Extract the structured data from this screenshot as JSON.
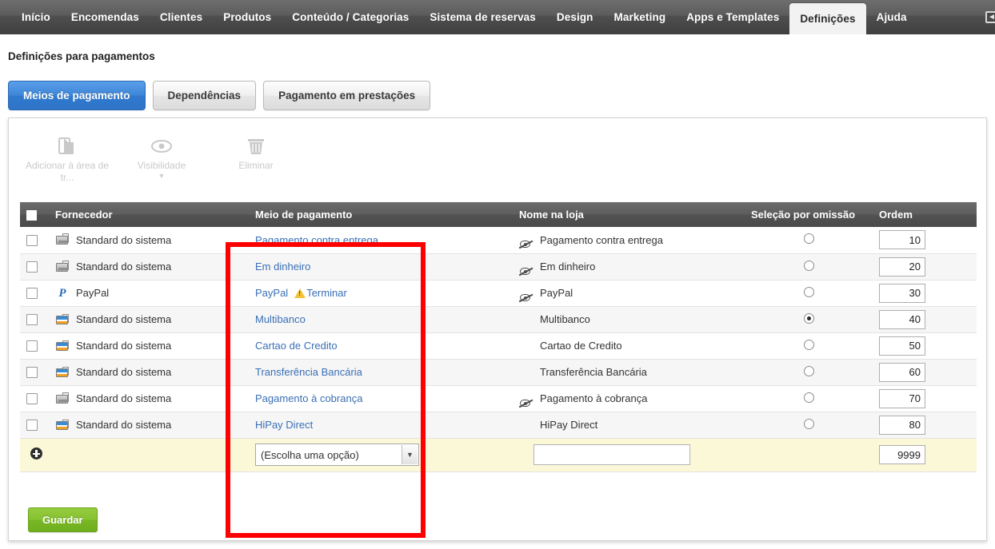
{
  "topnav": {
    "items": [
      {
        "label": "Início",
        "active": false
      },
      {
        "label": "Encomendas",
        "active": false
      },
      {
        "label": "Clientes",
        "active": false
      },
      {
        "label": "Produtos",
        "active": false
      },
      {
        "label": "Conteúdo / Categorias",
        "active": false
      },
      {
        "label": "Sistema de reservas",
        "active": false
      },
      {
        "label": "Design",
        "active": false
      },
      {
        "label": "Marketing",
        "active": false
      },
      {
        "label": "Apps e Templates",
        "active": false
      },
      {
        "label": "Definições",
        "active": true
      },
      {
        "label": "Ajuda",
        "active": false
      }
    ],
    "right_icon": "external-link-icon"
  },
  "page": {
    "title": "Definições para pagamentos"
  },
  "subtabs": [
    {
      "label": "Meios de pagamento",
      "active": true
    },
    {
      "label": "Dependências",
      "active": false
    },
    {
      "label": "Pagamento em prestações",
      "active": false
    }
  ],
  "toolbar": {
    "items": [
      {
        "label": "Adicionar à área de tr...",
        "icon": "clipboard-paste-icon",
        "enabled": false,
        "caret": false
      },
      {
        "label": "Visibilidade",
        "icon": "eye-icon",
        "enabled": false,
        "caret": true
      },
      {
        "label": "Eliminar",
        "icon": "trash-icon",
        "enabled": false,
        "caret": false
      }
    ]
  },
  "table": {
    "headers": {
      "select_all": "",
      "provider": "Fornecedor",
      "payment_method": "Meio de pagamento",
      "shop_name": "Nome na loja",
      "default_selection": "Seleção por omissão",
      "order": "Ordem"
    },
    "rows": [
      {
        "checked": false,
        "provider_icon": "card-gray-icon",
        "provider": "Standard do sistema",
        "method": "Pagamento contra entrega",
        "warning": "",
        "hidden_eye": true,
        "shop_name": "Pagamento contra entrega",
        "default": false,
        "order": "10"
      },
      {
        "checked": false,
        "provider_icon": "card-gray-icon",
        "provider": "Standard do sistema",
        "method": "Em dinheiro",
        "warning": "",
        "hidden_eye": true,
        "shop_name": "Em dinheiro",
        "default": false,
        "order": "20"
      },
      {
        "checked": false,
        "provider_icon": "paypal-icon",
        "provider": "PayPal",
        "method": "PayPal",
        "warning": "Terminar",
        "hidden_eye": true,
        "shop_name": "PayPal",
        "default": false,
        "order": "30"
      },
      {
        "checked": false,
        "provider_icon": "card-color-icon",
        "provider": "Standard do sistema",
        "method": "Multibanco",
        "warning": "",
        "hidden_eye": false,
        "shop_name": "Multibanco",
        "default": true,
        "order": "40"
      },
      {
        "checked": false,
        "provider_icon": "card-color-icon",
        "provider": "Standard do sistema",
        "method": "Cartao de Credito",
        "warning": "",
        "hidden_eye": false,
        "shop_name": "Cartao de Credito",
        "default": false,
        "order": "50"
      },
      {
        "checked": false,
        "provider_icon": "card-color-icon",
        "provider": "Standard do sistema",
        "method": "Transferência Bancária",
        "warning": "",
        "hidden_eye": false,
        "shop_name": "Transferência Bancária",
        "default": false,
        "order": "60"
      },
      {
        "checked": false,
        "provider_icon": "card-gray-icon",
        "provider": "Standard do sistema",
        "method": "Pagamento à cobrança",
        "warning": "",
        "hidden_eye": true,
        "shop_name": "Pagamento à cobrança",
        "default": false,
        "order": "70"
      },
      {
        "checked": false,
        "provider_icon": "card-color-icon",
        "provider": "Standard do sistema",
        "method": "HiPay Direct",
        "warning": "",
        "hidden_eye": false,
        "shop_name": "HiPay Direct",
        "default": false,
        "order": "80"
      }
    ],
    "add_row": {
      "add_icon": "plus-circle-icon",
      "select_value": "(Escolha uma opção)",
      "shop_name_value": "",
      "shop_name_placeholder": "",
      "order": "9999"
    }
  },
  "save_button": {
    "label": "Guardar"
  },
  "annotation": {
    "highlight_color": "#ff0000",
    "highlight_target": "meio-de-pagamento-column"
  }
}
